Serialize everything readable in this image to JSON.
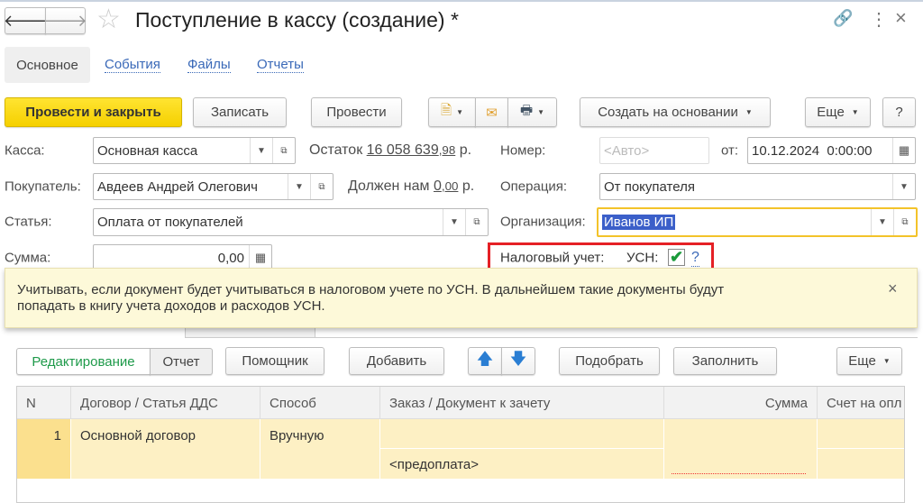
{
  "header": {
    "title": "Поступление в кассу (создание) *"
  },
  "tabs": [
    {
      "label": "Основное"
    },
    {
      "label": "События"
    },
    {
      "label": "Файлы"
    },
    {
      "label": "Отчеты"
    }
  ],
  "toolbar": {
    "post_close": "Провести и закрыть",
    "save": "Записать",
    "post": "Провести",
    "create_based": "Создать на основании",
    "more": "Еще",
    "help": "?"
  },
  "form": {
    "kassa_label": "Касса:",
    "kassa_value": "Основная касса",
    "ostatok_label": "Остаток",
    "ostatok_int": "16 058 639",
    "ostatok_frac": ",98",
    "ostatok_cur": "р.",
    "nomer_label": "Номер:",
    "nomer_placeholder": "<Авто>",
    "ot_label": "от:",
    "date_value": "10.12.2024  0:00:00",
    "buyer_label": "Покупатель:",
    "buyer_value": "Авдеев Андрей Олегович",
    "owes_label": "Должен нам",
    "owes_int": "0",
    "owes_frac": ",00",
    "owes_cur": "р.",
    "operation_label": "Операция:",
    "operation_value": "От покупателя",
    "article_label": "Статья:",
    "article_value": "Оплата от покупателей",
    "org_label": "Организация:",
    "org_value": "Иванов ИП",
    "sum_label": "Сумма:",
    "sum_value": "0,00",
    "tax_label": "Налоговый учет:",
    "usn_label": "УСН:",
    "usn_checked": true,
    "help_link": "?"
  },
  "tooltip": {
    "line1": "Учитывать, если документ будет учитываться в налоговом учете по УСН. В дальнейшем такие документы будут",
    "line2": "попадать в книгу учета доходов и расходов УСН.",
    "close": "×"
  },
  "table_toolbar": {
    "edit": "Редактирование",
    "report": "Отчет",
    "assistant": "Помощник",
    "add": "Добавить",
    "pick": "Подобрать",
    "fill": "Заполнить",
    "more": "Еще"
  },
  "table": {
    "columns": [
      "N",
      "Договор / Статья ДДС",
      "Способ",
      "Заказ / Документ к зачету",
      "Сумма",
      "Счет на опл"
    ],
    "rows": [
      {
        "n": "1",
        "contract": "Основной договор",
        "method": "Вручную",
        "order": "<предоплата>",
        "sum": "",
        "invoice": ""
      }
    ]
  }
}
